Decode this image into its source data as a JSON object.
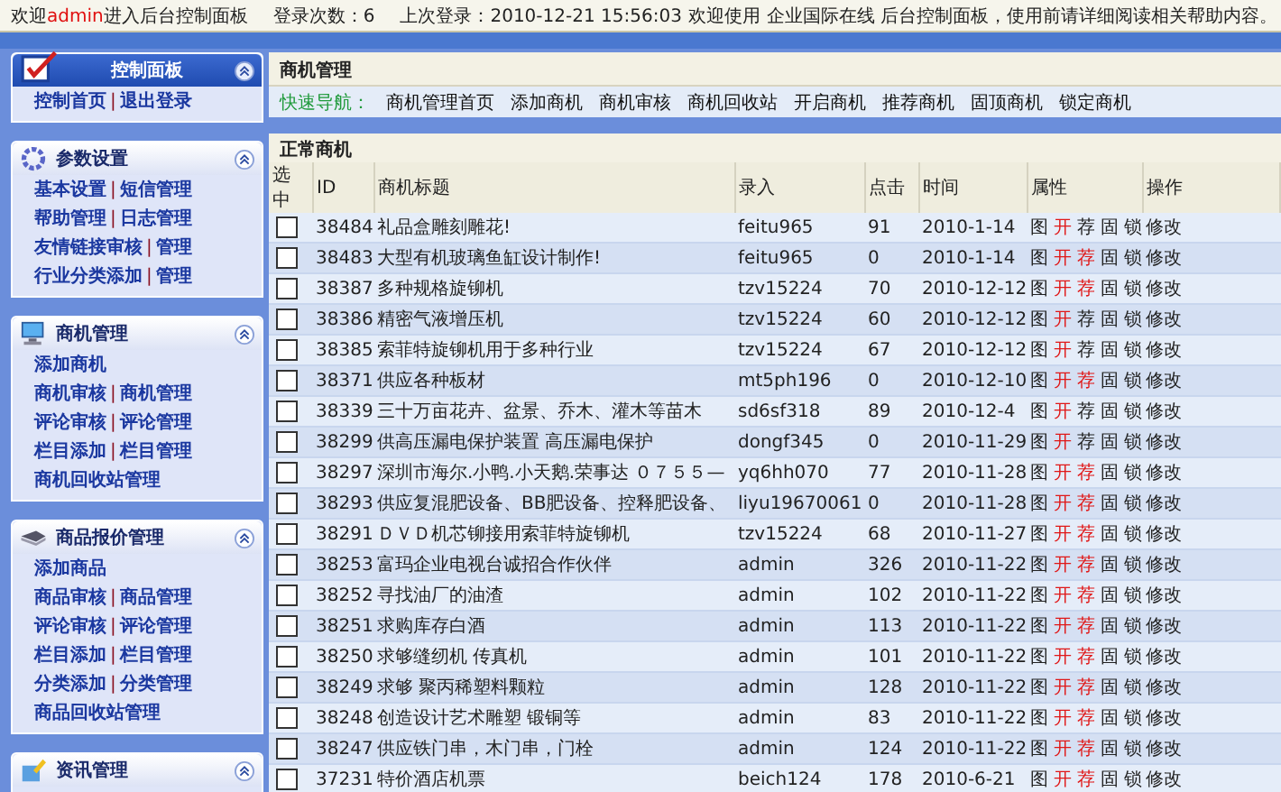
{
  "top_bar": {
    "welcome_prefix": "欢迎",
    "user": "admin",
    "welcome_suffix": "进入后台控制面板",
    "login_count": "登录次数：6",
    "last_login": "上次登录：2010-12-21 15:56:03",
    "notice": "欢迎使用 企业国际在线 后台控制面板，使用前请详细阅读相关帮助内容。"
  },
  "sidebar": [
    {
      "title": "控制面板",
      "kind": "primary",
      "rows": [
        {
          "links": [
            "控制首页",
            "退出登录"
          ],
          "separator": "|"
        }
      ]
    },
    {
      "title": "参数设置",
      "kind": "normal",
      "rows": [
        {
          "links": [
            "基本设置",
            "短信管理"
          ],
          "separator": "|"
        },
        {
          "links": [
            "帮助管理",
            "日志管理"
          ],
          "separator": "|"
        },
        {
          "links": [
            "友情链接审核",
            "管理"
          ],
          "separator": "|"
        },
        {
          "links": [
            "行业分类添加",
            "管理"
          ],
          "separator": "|"
        }
      ]
    },
    {
      "title": "商机管理",
      "kind": "normal",
      "rows": [
        {
          "links": [
            "添加商机"
          ]
        },
        {
          "links": [
            "商机审核",
            "商机管理"
          ],
          "separator": "|"
        },
        {
          "links": [
            "评论审核",
            "评论管理"
          ],
          "separator": "|"
        },
        {
          "links": [
            "栏目添加",
            "栏目管理"
          ],
          "separator": "|"
        },
        {
          "links": [
            "商机回收站管理"
          ]
        }
      ]
    },
    {
      "title": "商品报价管理",
      "kind": "normal",
      "rows": [
        {
          "links": [
            "添加商品"
          ]
        },
        {
          "links": [
            "商品审核",
            "商品管理"
          ],
          "separator": "|"
        },
        {
          "links": [
            "评论审核",
            "评论管理"
          ],
          "separator": "|"
        },
        {
          "links": [
            "栏目添加",
            "栏目管理"
          ],
          "separator": "|"
        },
        {
          "links": [
            "分类添加",
            "分类管理"
          ],
          "separator": "|"
        },
        {
          "links": [
            "商品回收站管理"
          ]
        }
      ]
    },
    {
      "title": "资讯管理",
      "kind": "normal"
    }
  ],
  "main": {
    "title": "商机管理",
    "quick_nav_label": "快速导航：",
    "quick_nav": [
      "商机管理首页",
      "添加商机",
      "商机审核",
      "商机回收站",
      "开启商机",
      "推荐商机",
      "固顶商机",
      "锁定商机"
    ],
    "section_title": "正常商机",
    "columns": [
      "选中",
      "ID",
      "商机标题",
      "录入",
      "点击",
      "时间",
      "属性",
      "操作"
    ],
    "rows": [
      {
        "checked": false,
        "id": "38484",
        "title": "礼品盒雕刻雕花!",
        "author": "feitu965",
        "clicks": "91",
        "date": "2010-1-14",
        "attributes": [
          {
            "label": "图",
            "on": false
          },
          {
            "label": "开",
            "on": true
          },
          {
            "label": "荐",
            "on": false
          },
          {
            "label": "固",
            "on": false
          },
          {
            "label": "锁",
            "on": false
          }
        ],
        "action": "修改"
      },
      {
        "checked": false,
        "id": "38483",
        "title": "大型有机玻璃鱼缸设计制作!",
        "author": "feitu965",
        "clicks": "0",
        "date": "2010-1-14",
        "attributes": [
          {
            "label": "图",
            "on": false
          },
          {
            "label": "开",
            "on": true
          },
          {
            "label": "荐",
            "on": true
          },
          {
            "label": "固",
            "on": false
          },
          {
            "label": "锁",
            "on": false
          }
        ],
        "action": "修改"
      },
      {
        "checked": false,
        "id": "38387",
        "title": "多种规格旋铆机",
        "author": "tzv15224",
        "clicks": "70",
        "date": "2010-12-12",
        "attributes": [
          {
            "label": "图",
            "on": false
          },
          {
            "label": "开",
            "on": true
          },
          {
            "label": "荐",
            "on": true
          },
          {
            "label": "固",
            "on": false
          },
          {
            "label": "锁",
            "on": false
          }
        ],
        "action": "修改"
      },
      {
        "checked": false,
        "id": "38386",
        "title": "精密气液增压机",
        "author": "tzv15224",
        "clicks": "60",
        "date": "2010-12-12",
        "attributes": [
          {
            "label": "图",
            "on": false
          },
          {
            "label": "开",
            "on": true
          },
          {
            "label": "荐",
            "on": false
          },
          {
            "label": "固",
            "on": false
          },
          {
            "label": "锁",
            "on": false
          }
        ],
        "action": "修改"
      },
      {
        "checked": false,
        "id": "38385",
        "title": "索菲特旋铆机用于多种行业",
        "author": "tzv15224",
        "clicks": "67",
        "date": "2010-12-12",
        "attributes": [
          {
            "label": "图",
            "on": false
          },
          {
            "label": "开",
            "on": true
          },
          {
            "label": "荐",
            "on": false
          },
          {
            "label": "固",
            "on": false
          },
          {
            "label": "锁",
            "on": false
          }
        ],
        "action": "修改"
      },
      {
        "checked": false,
        "id": "38371",
        "title": "供应各种板材",
        "author": "mt5ph196",
        "clicks": "0",
        "date": "2010-12-10",
        "attributes": [
          {
            "label": "图",
            "on": false
          },
          {
            "label": "开",
            "on": true
          },
          {
            "label": "荐",
            "on": true
          },
          {
            "label": "固",
            "on": false
          },
          {
            "label": "锁",
            "on": false
          }
        ],
        "action": "修改"
      },
      {
        "checked": false,
        "id": "38339",
        "title": "三十万亩花卉、盆景、乔木、灌木等苗木",
        "author": "sd6sf318",
        "clicks": "89",
        "date": "2010-12-4",
        "attributes": [
          {
            "label": "图",
            "on": false
          },
          {
            "label": "开",
            "on": true
          },
          {
            "label": "荐",
            "on": false
          },
          {
            "label": "固",
            "on": false
          },
          {
            "label": "锁",
            "on": false
          }
        ],
        "action": "修改"
      },
      {
        "checked": false,
        "id": "38299",
        "title": "供高压漏电保护装置 高压漏电保护",
        "author": "dongf345",
        "clicks": "0",
        "date": "2010-11-29",
        "attributes": [
          {
            "label": "图",
            "on": false
          },
          {
            "label": "开",
            "on": true
          },
          {
            "label": "荐",
            "on": false
          },
          {
            "label": "固",
            "on": false
          },
          {
            "label": "锁",
            "on": false
          }
        ],
        "action": "修改"
      },
      {
        "checked": false,
        "id": "38297",
        "title": "深圳市海尔.小鸭.小天鹅.荣事达 ０７５５—",
        "author": "yq6hh070",
        "clicks": "77",
        "date": "2010-11-28",
        "attributes": [
          {
            "label": "图",
            "on": false
          },
          {
            "label": "开",
            "on": true
          },
          {
            "label": "荐",
            "on": true
          },
          {
            "label": "固",
            "on": false
          },
          {
            "label": "锁",
            "on": false
          }
        ],
        "action": "修改"
      },
      {
        "checked": false,
        "id": "38293",
        "title": "供应复混肥设备、BB肥设备、控释肥设备、",
        "author": "liyu19670061",
        "clicks": "0",
        "date": "2010-11-28",
        "attributes": [
          {
            "label": "图",
            "on": false
          },
          {
            "label": "开",
            "on": true
          },
          {
            "label": "荐",
            "on": true
          },
          {
            "label": "固",
            "on": false
          },
          {
            "label": "锁",
            "on": false
          }
        ],
        "action": "修改"
      },
      {
        "checked": false,
        "id": "38291",
        "title": "ＤＶＤ机芯铆接用索菲特旋铆机",
        "author": "tzv15224",
        "clicks": "68",
        "date": "2010-11-27",
        "attributes": [
          {
            "label": "图",
            "on": false
          },
          {
            "label": "开",
            "on": true
          },
          {
            "label": "荐",
            "on": true
          },
          {
            "label": "固",
            "on": false
          },
          {
            "label": "锁",
            "on": false
          }
        ],
        "action": "修改"
      },
      {
        "checked": false,
        "id": "38253",
        "title": "富玛企业电视台诚招合作伙伴",
        "author": "admin",
        "clicks": "326",
        "date": "2010-11-22",
        "attributes": [
          {
            "label": "图",
            "on": false
          },
          {
            "label": "开",
            "on": true
          },
          {
            "label": "荐",
            "on": true
          },
          {
            "label": "固",
            "on": false
          },
          {
            "label": "锁",
            "on": false
          }
        ],
        "action": "修改"
      },
      {
        "checked": false,
        "id": "38252",
        "title": "寻找油厂的油渣",
        "author": "admin",
        "clicks": "102",
        "date": "2010-11-22",
        "attributes": [
          {
            "label": "图",
            "on": false
          },
          {
            "label": "开",
            "on": true
          },
          {
            "label": "荐",
            "on": true
          },
          {
            "label": "固",
            "on": false
          },
          {
            "label": "锁",
            "on": false
          }
        ],
        "action": "修改"
      },
      {
        "checked": false,
        "id": "38251",
        "title": "求购库存白酒",
        "author": "admin",
        "clicks": "113",
        "date": "2010-11-22",
        "attributes": [
          {
            "label": "图",
            "on": false
          },
          {
            "label": "开",
            "on": true
          },
          {
            "label": "荐",
            "on": true
          },
          {
            "label": "固",
            "on": false
          },
          {
            "label": "锁",
            "on": false
          }
        ],
        "action": "修改"
      },
      {
        "checked": false,
        "id": "38250",
        "title": "求够缝纫机 传真机",
        "author": "admin",
        "clicks": "101",
        "date": "2010-11-22",
        "attributes": [
          {
            "label": "图",
            "on": false
          },
          {
            "label": "开",
            "on": true
          },
          {
            "label": "荐",
            "on": true
          },
          {
            "label": "固",
            "on": false
          },
          {
            "label": "锁",
            "on": false
          }
        ],
        "action": "修改"
      },
      {
        "checked": false,
        "id": "38249",
        "title": "求够 聚丙稀塑料颗粒",
        "author": "admin",
        "clicks": "128",
        "date": "2010-11-22",
        "attributes": [
          {
            "label": "图",
            "on": false
          },
          {
            "label": "开",
            "on": true
          },
          {
            "label": "荐",
            "on": true
          },
          {
            "label": "固",
            "on": false
          },
          {
            "label": "锁",
            "on": false
          }
        ],
        "action": "修改"
      },
      {
        "checked": false,
        "id": "38248",
        "title": "创造设计艺术雕塑 锻铜等",
        "author": "admin",
        "clicks": "83",
        "date": "2010-11-22",
        "attributes": [
          {
            "label": "图",
            "on": false
          },
          {
            "label": "开",
            "on": true
          },
          {
            "label": "荐",
            "on": true
          },
          {
            "label": "固",
            "on": false
          },
          {
            "label": "锁",
            "on": false
          }
        ],
        "action": "修改"
      },
      {
        "checked": false,
        "id": "38247",
        "title": "供应铁门串，木门串，门栓",
        "author": "admin",
        "clicks": "124",
        "date": "2010-11-22",
        "attributes": [
          {
            "label": "图",
            "on": false
          },
          {
            "label": "开",
            "on": true
          },
          {
            "label": "荐",
            "on": true
          },
          {
            "label": "固",
            "on": false
          },
          {
            "label": "锁",
            "on": false
          }
        ],
        "action": "修改"
      },
      {
        "checked": false,
        "id": "37231",
        "title": "特价酒店机票",
        "author": "beich124",
        "clicks": "178",
        "date": "2010-6-21",
        "attributes": [
          {
            "label": "图",
            "on": false
          },
          {
            "label": "开",
            "on": true
          },
          {
            "label": "荐",
            "on": true
          },
          {
            "label": "固",
            "on": false
          },
          {
            "label": "锁",
            "on": false
          }
        ],
        "action": "修改"
      }
    ]
  }
}
